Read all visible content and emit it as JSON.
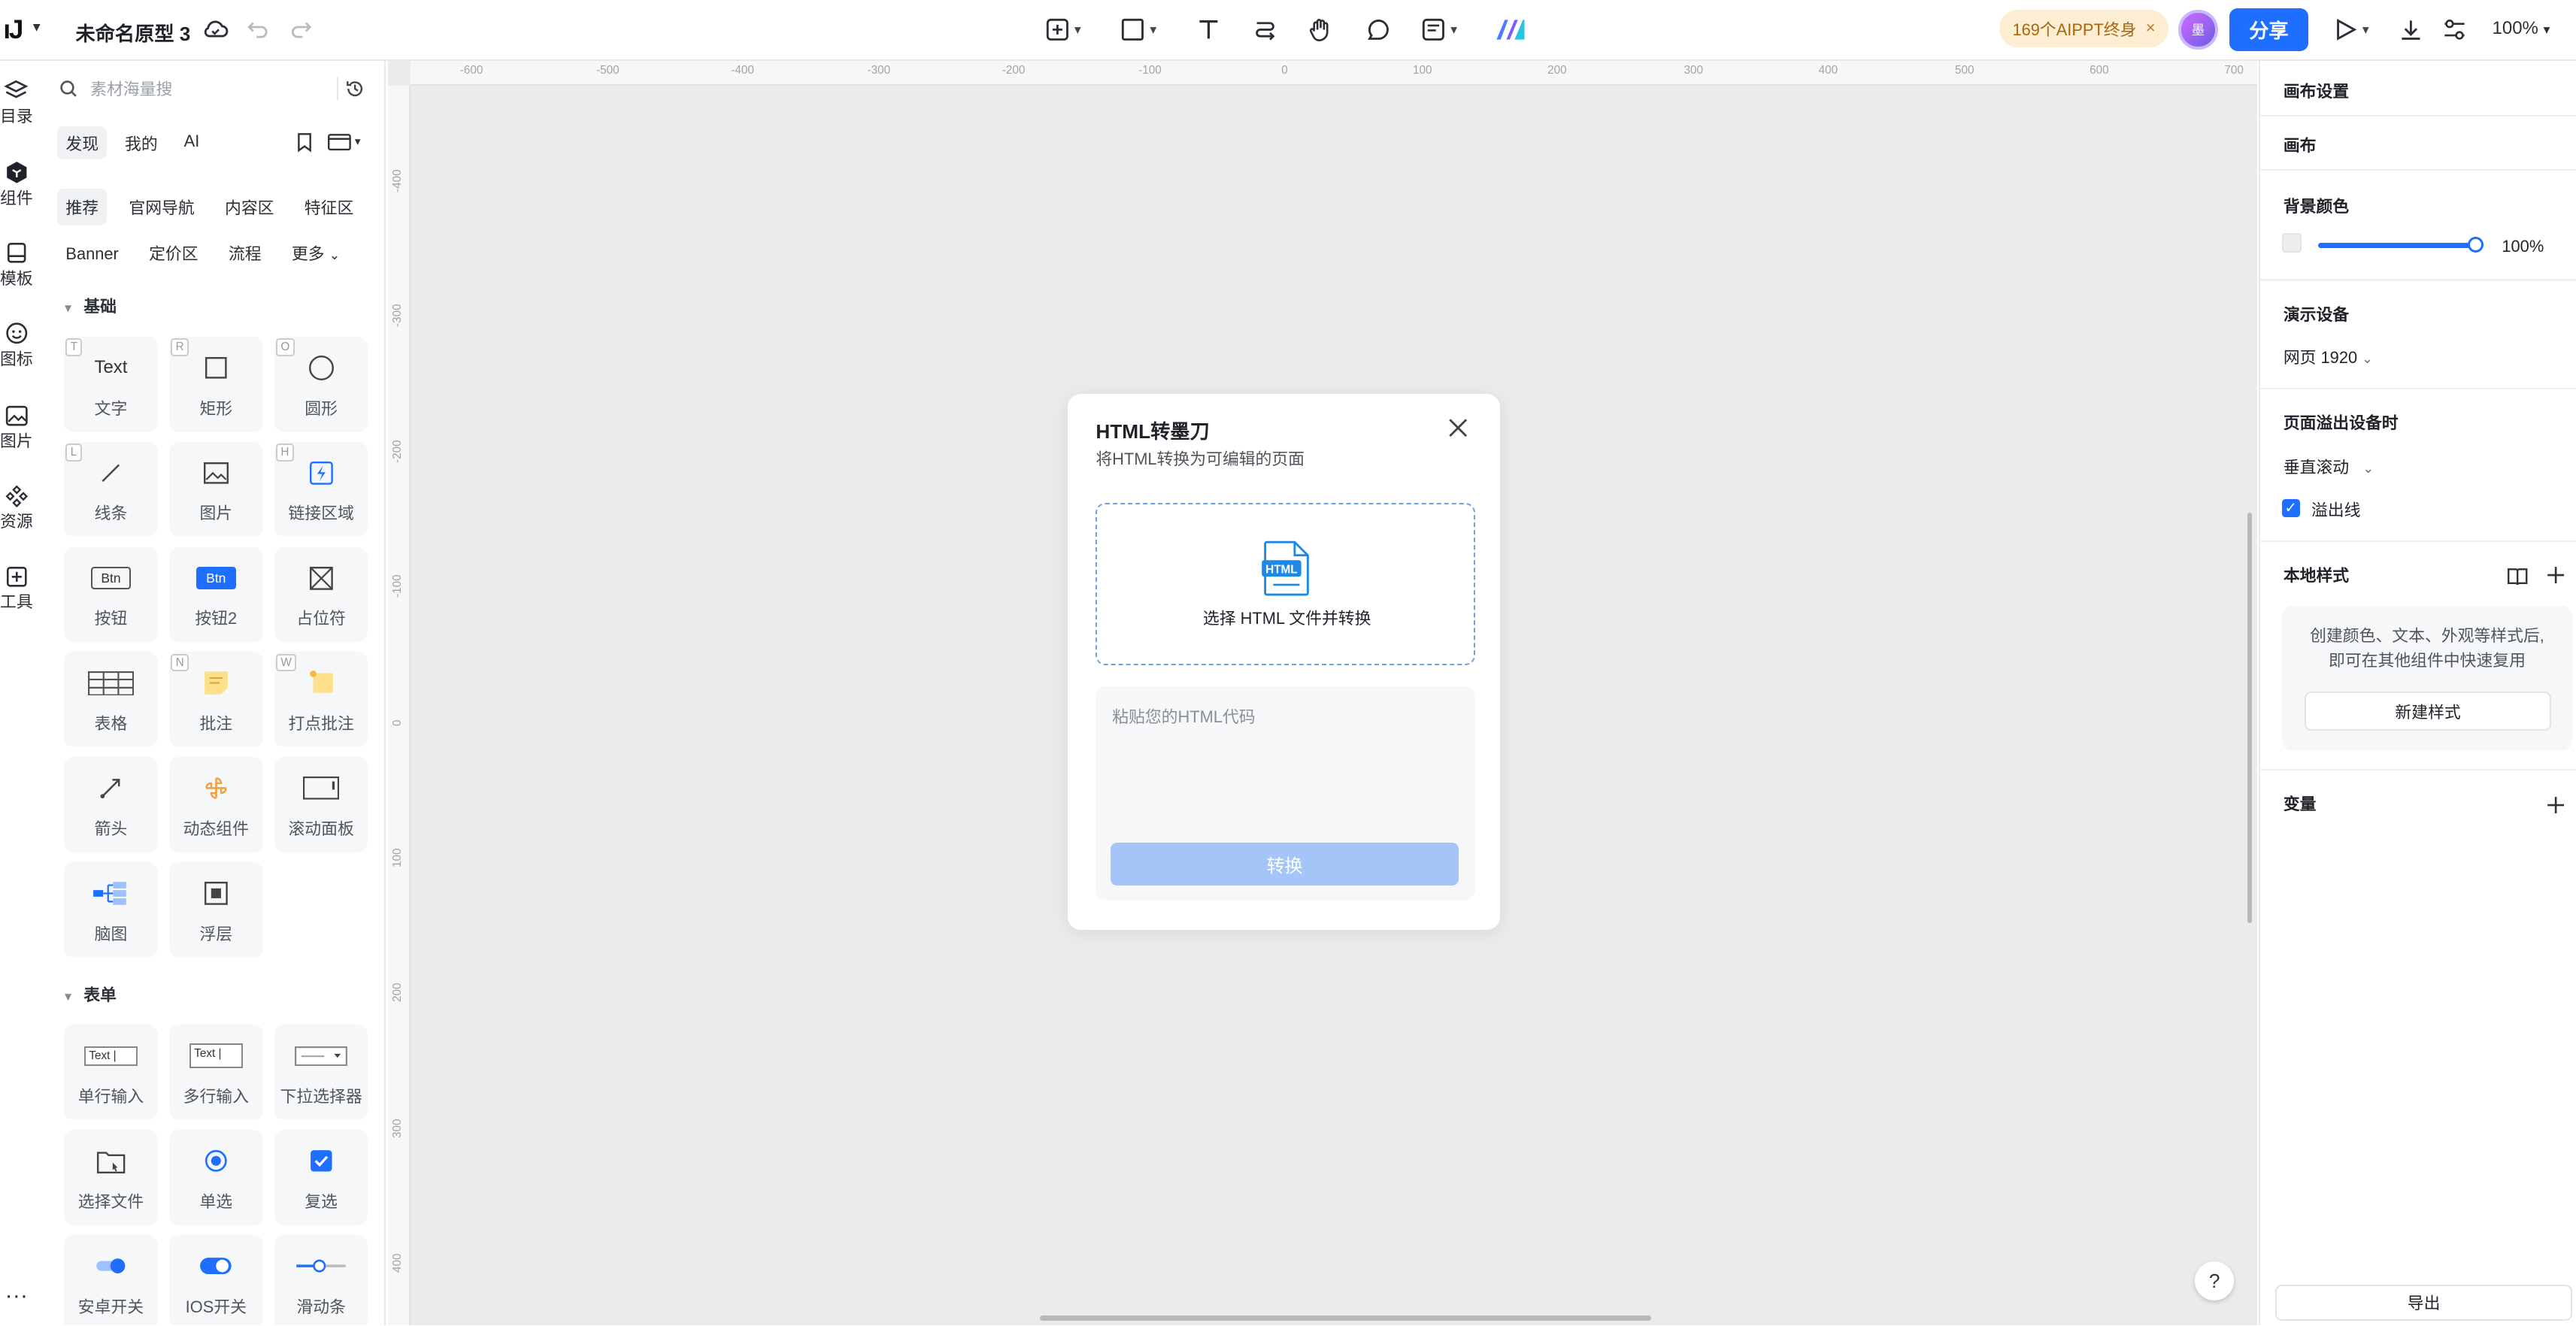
{
  "topbar": {
    "logo": "ıJ",
    "project_title": "未命名原型 3",
    "badge_text": "169个AIPPT终身",
    "badge_close": "×",
    "avatar_text": "墨",
    "share_label": "分享",
    "zoom": "100%"
  },
  "rail": {
    "items": [
      {
        "label": "目录",
        "icon": "layers-icon"
      },
      {
        "label": "组件",
        "icon": "component-icon"
      },
      {
        "label": "模板",
        "icon": "bookmark-icon"
      },
      {
        "label": "图标",
        "icon": "smile-icon"
      },
      {
        "label": "图片",
        "icon": "image-icon"
      },
      {
        "label": "资源",
        "icon": "resource-icon"
      },
      {
        "label": "工具",
        "icon": "plus-square-icon"
      }
    ],
    "more": "···"
  },
  "library": {
    "search_placeholder": "素材海量搜",
    "tabs": [
      "发现",
      "我的",
      "AI"
    ],
    "chips_row1": [
      "推荐",
      "官网导航",
      "内容区",
      "特征区"
    ],
    "chips_row2": [
      "Banner",
      "定价区",
      "流程",
      "更多"
    ],
    "section_basic": "基础",
    "section_form": "表单",
    "basic_items": [
      {
        "label": "文字",
        "key": "T",
        "icon": "text-icon",
        "icon_text": "Text"
      },
      {
        "label": "矩形",
        "key": "R",
        "icon": "rectangle-icon"
      },
      {
        "label": "圆形",
        "key": "O",
        "icon": "circle-icon"
      },
      {
        "label": "线条",
        "key": "L",
        "icon": "line-icon"
      },
      {
        "label": "图片",
        "key": "",
        "icon": "picture-icon"
      },
      {
        "label": "链接区域",
        "key": "H",
        "icon": "link-area-icon"
      },
      {
        "label": "按钮",
        "key": "",
        "icon": "button-icon",
        "icon_text": "Btn"
      },
      {
        "label": "按钮2",
        "key": "",
        "icon": "button2-icon",
        "icon_text": "Btn"
      },
      {
        "label": "占位符",
        "key": "",
        "icon": "placeholder-icon"
      },
      {
        "label": "表格",
        "key": "",
        "icon": "table-icon"
      },
      {
        "label": "批注",
        "key": "N",
        "icon": "note-icon"
      },
      {
        "label": "打点批注",
        "key": "W",
        "icon": "dot-note-icon"
      },
      {
        "label": "箭头",
        "key": "",
        "icon": "arrow-icon"
      },
      {
        "label": "动态组件",
        "key": "",
        "icon": "dynamic-icon"
      },
      {
        "label": "滚动面板",
        "key": "",
        "icon": "scroll-panel-icon"
      },
      {
        "label": "脑图",
        "key": "",
        "icon": "mindmap-icon"
      },
      {
        "label": "浮层",
        "key": "",
        "icon": "overlay-icon"
      }
    ],
    "form_items": [
      {
        "label": "单行输入",
        "icon": "single-input-icon",
        "icon_text": "Text |"
      },
      {
        "label": "多行输入",
        "icon": "multi-input-icon",
        "icon_text": "Text |"
      },
      {
        "label": "下拉选择器",
        "icon": "select-icon"
      },
      {
        "label": "选择文件",
        "icon": "file-select-icon"
      },
      {
        "label": "单选",
        "icon": "radio-icon"
      },
      {
        "label": "复选",
        "icon": "checkbox-icon"
      },
      {
        "label": "安卓开关",
        "icon": "android-switch-icon"
      },
      {
        "label": "IOS开关",
        "icon": "ios-switch-icon"
      },
      {
        "label": "滑动条",
        "icon": "slider-icon"
      }
    ]
  },
  "canvas": {
    "ruler_top": [
      "-600",
      "-500",
      "-400",
      "-300",
      "-200",
      "-100",
      "0",
      "100",
      "200",
      "300",
      "400",
      "500",
      "600",
      "700"
    ],
    "ruler_left": [
      "-400",
      "-300",
      "-200",
      "-100",
      "0",
      "100",
      "200",
      "300",
      "400"
    ],
    "help": "?"
  },
  "dialog": {
    "title": "HTML转墨刀",
    "subtitle": "将HTML转换为可编辑的页面",
    "file_badge": "HTML",
    "drop_label": "选择 HTML 文件并转换",
    "code_placeholder": "粘贴您的HTML代码",
    "convert_label": "转换"
  },
  "right_panel": {
    "canvas_settings": "画布设置",
    "canvas": "画布",
    "bg_color": "背景颜色",
    "opacity": "100%",
    "opacity_value": 1.0,
    "demo_device": "演示设备",
    "device_value": "网页 1920",
    "overflow_title": "页面溢出设备时",
    "overflow_value": "垂直滚动",
    "overflow_line": "溢出线",
    "local_styles": "本地样式",
    "style_desc_1": "创建颜色、文本、外观等样式后,",
    "style_desc_2": "即可在其他组件中快速复用",
    "new_style": "新建样式",
    "variables": "变量",
    "export": "导出"
  },
  "colors": {
    "accent": "#1e6fff",
    "badge_bg": "#fdeed3",
    "canvas_bg": "#ebebeb",
    "convert_disabled": "#a3c5f7"
  }
}
